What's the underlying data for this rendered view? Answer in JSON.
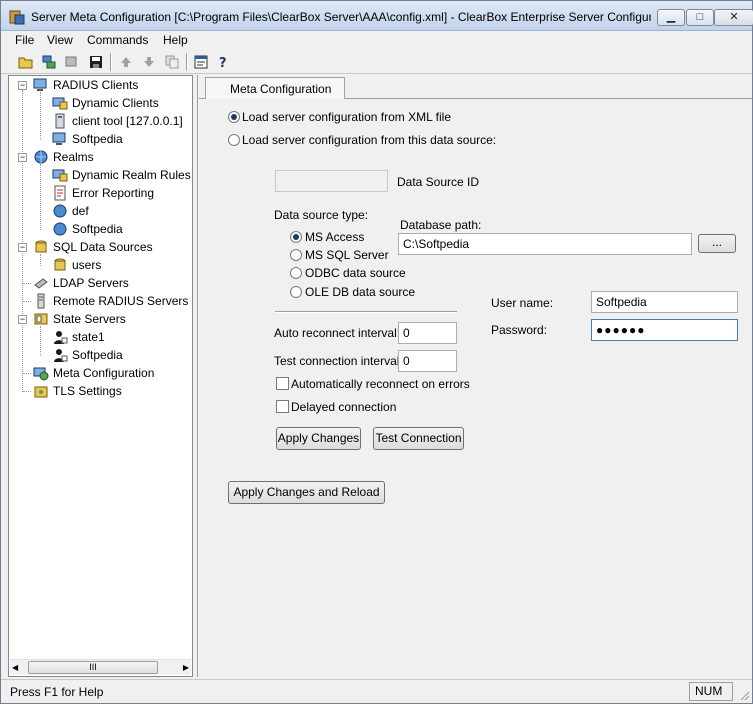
{
  "window": {
    "title": "Server Meta Configuration [C:\\Program Files\\ClearBox Server\\AAA\\config.xml] - ClearBox Enterprise Server Configur...",
    "minimize": "▁",
    "maximize": "□",
    "close": "✕"
  },
  "menu": [
    "File",
    "View",
    "Commands",
    "Help"
  ],
  "tree": {
    "nodes": [
      {
        "label": "RADIUS Clients"
      },
      {
        "label": "Dynamic Clients"
      },
      {
        "label": "client tool [127.0.0.1]"
      },
      {
        "label": "Softpedia"
      },
      {
        "label": "Realms"
      },
      {
        "label": "Dynamic Realm Rules"
      },
      {
        "label": "Error Reporting"
      },
      {
        "label": "def"
      },
      {
        "label": "Softpedia"
      },
      {
        "label": "SQL Data Sources"
      },
      {
        "label": "users"
      },
      {
        "label": "LDAP Servers"
      },
      {
        "label": "Remote RADIUS Servers"
      },
      {
        "label": "State Servers"
      },
      {
        "label": "state1"
      },
      {
        "label": "Softpedia"
      },
      {
        "label": "Meta Configuration"
      },
      {
        "label": "TLS Settings"
      }
    ],
    "scroll_grip": "III"
  },
  "tab": {
    "label": "Meta Configuration"
  },
  "form": {
    "load_xml": "Load server configuration from XML file",
    "load_ds": "Load server configuration from this data source:",
    "ds_id_label": "Data Source ID",
    "ds_id_value": "",
    "ds_type_label": "Data source type:",
    "ds_types": [
      "MS Access",
      "MS SQL Server",
      "ODBC data source",
      "OLE DB data source"
    ],
    "db_path_label": "Database path:",
    "db_path_value": "C:\\Softpedia",
    "browse_label": "...",
    "auto_reconnect_label": "Auto reconnect interval:",
    "auto_reconnect_value": "0",
    "test_conn_label": "Test connection interval:",
    "test_conn_value": "0",
    "auto_reconnect_errors": "Automatically reconnect on errors",
    "delayed_conn": "Delayed connection",
    "user_label": "User name:",
    "user_value": "Softpedia",
    "password_label": "Password:",
    "password_value": "●●●●●●",
    "apply_changes": "Apply Changes",
    "test_connection": "Test Connection",
    "apply_reload": "Apply Changes and Reload"
  },
  "status": {
    "text": "Press F1 for Help",
    "num": "NUM"
  }
}
